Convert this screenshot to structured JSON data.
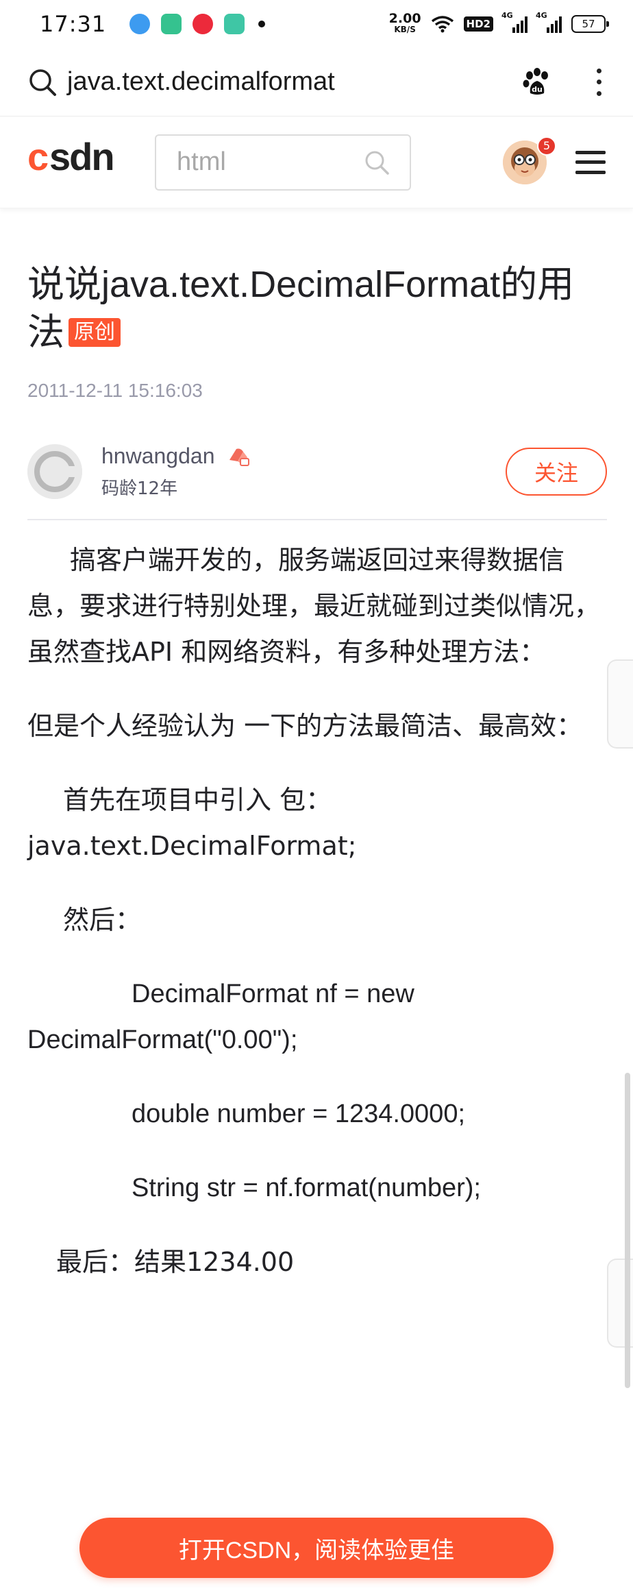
{
  "status_bar": {
    "time": "17:31",
    "net_speed": "2.00",
    "net_unit": "KB/S",
    "hd_label": "HD2",
    "signal_1_label": "4G",
    "signal_2_label": "4G",
    "battery": "57"
  },
  "browser": {
    "url_text": "java.text.decimalformat",
    "search_icon": "search-icon",
    "baidu_icon": "baidu-paw-icon",
    "more_icon": "more-vertical-icon"
  },
  "csdn_header": {
    "logo_text": "CSDN",
    "search_placeholder": "html",
    "notification_count": "5",
    "menu_icon": "hamburger-menu-icon"
  },
  "article": {
    "title": "说说java.text.DecimalFormat的用法",
    "tag": "原创",
    "date": "2011-12-11 15:16:03",
    "author": {
      "name": "hnwangdan",
      "coding_age": "码龄12年",
      "follow_label": "关注"
    },
    "paragraphs": [
      "搞客户端开发的，服务端返回过来得数据信息，要求进行特别处理，最近就碰到过类似情况，虽然查找API 和网络资料，有多种处理方法：",
      "但是个人经验认为 一下的方法最简洁、最高效：",
      "首先在项目中引入 包：java.text.DecimalFormat;",
      "然后：",
      "DecimalFormat nf = new DecimalFormat(\"0.00\");",
      "double number = 1234.0000;",
      "String str = nf.format(number);",
      "最后：结果1234.00"
    ]
  },
  "open_app_button": "打开CSDN，阅读体验更佳",
  "colors": {
    "brand": "#fc5531",
    "text": "#222226",
    "muted": "#999aaa"
  }
}
